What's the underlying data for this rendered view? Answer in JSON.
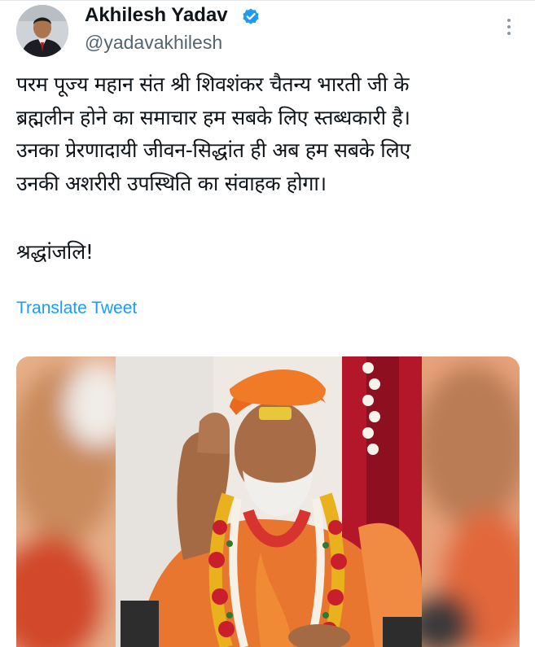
{
  "author": {
    "display_name": "Akhilesh Yadav",
    "handle": "@yadavakhilesh",
    "verified_icon": "verified-badge-icon",
    "avatar_icon": "profile-photo"
  },
  "tweet": {
    "lines": [
      "परम पूज्य महान संत श्री शिवशंकर चैतन्य भारती जी के",
      "ब्रह्मलीन होने का समाचार हम सबके लिए स्तब्धकारी है।",
      "उनका प्रेरणादायी जीवन-सिद्धांत ही अब हम सबके लिए",
      "उनकी अशरीरी उपस्थिति का संवाहक होगा।"
    ],
    "closing": "श्रद्धांजलि!",
    "translate_label": "Translate Tweet"
  },
  "more_icon": "more-options-icon",
  "colors": {
    "link": "#1d9bf0",
    "verified": "#1d9bf0",
    "secondary_text": "#536471",
    "primary_text": "#0f1419"
  }
}
